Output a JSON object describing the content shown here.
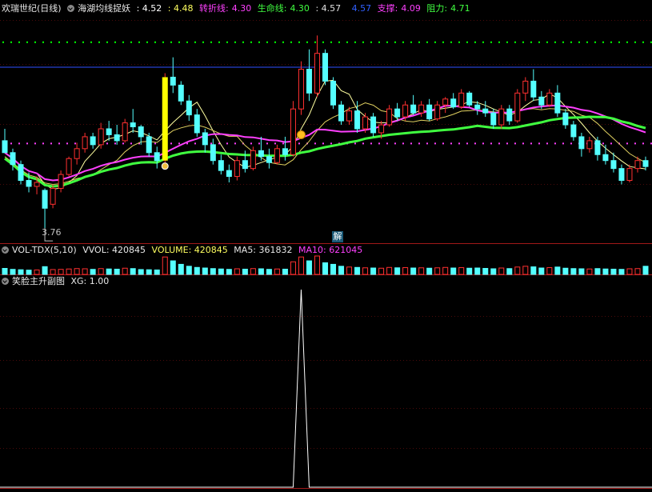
{
  "header": {
    "stock_name": "欢瑞世纪(日线)",
    "indicator_name": "海湖均线捉妖",
    "val1": ": 4.52",
    "val2": ": 4.48",
    "zhuanzhe_label": "转折线:",
    "zhuanzhe_val": "4.30",
    "shengming_label": "生命线:",
    "shengming_val": "4.30",
    "val3": ": 4.57",
    "val4": "4.57",
    "zhicheng_label": "支撑:",
    "zhicheng_val": "4.09",
    "zuli_label": "阻力:",
    "zuli_val": "4.71"
  },
  "vol_header": {
    "name": "VOL-TDX(5,10)",
    "vvol": "VVOL: 420845",
    "volume": "VOLUME: 420845",
    "ma5": "MA5: 361832",
    "ma10": "MA10: 621045"
  },
  "xg_header": {
    "name": "笑脸主升副图",
    "xg": "XG: 1.00"
  },
  "low_label": "3.76",
  "jie_label": "解",
  "colors": {
    "up": "#ff3030",
    "down": "#54ffff",
    "ma_fast": "#ffffa0",
    "zhuanzhe": "#ff40ff",
    "shengming": "#40ff40",
    "blue_line": "#3050ff",
    "dots_green": "#00ff00",
    "dots_pink": "#ff40ff",
    "bar_yellow": "#ffff00"
  },
  "chart_data": {
    "type": "candlestick",
    "candles": [
      [
        4.2,
        4.26,
        4.14,
        4.14
      ],
      [
        4.14,
        4.16,
        4.05,
        4.08
      ],
      [
        4.08,
        4.1,
        3.98,
        4.0
      ],
      [
        4.0,
        4.04,
        3.94,
        3.97
      ],
      [
        3.97,
        4.02,
        3.93,
        3.99
      ],
      [
        3.95,
        3.96,
        3.76,
        3.86
      ],
      [
        3.88,
        3.98,
        3.86,
        3.96
      ],
      [
        3.96,
        4.05,
        3.94,
        4.03
      ],
      [
        4.03,
        4.12,
        4.02,
        4.11
      ],
      [
        4.11,
        4.19,
        4.08,
        4.16
      ],
      [
        4.16,
        4.24,
        4.14,
        4.22
      ],
      [
        4.22,
        4.24,
        4.16,
        4.18
      ],
      [
        4.18,
        4.29,
        4.16,
        4.26
      ],
      [
        4.26,
        4.3,
        4.2,
        4.23
      ],
      [
        4.23,
        4.28,
        4.18,
        4.2
      ],
      [
        4.2,
        4.31,
        4.19,
        4.29
      ],
      [
        4.29,
        4.36,
        4.24,
        4.27
      ],
      [
        4.27,
        4.28,
        4.18,
        4.22
      ],
      [
        4.22,
        4.24,
        4.12,
        4.14
      ],
      [
        4.14,
        4.17,
        4.06,
        4.1
      ],
      [
        4.1,
        4.54,
        4.09,
        4.52
      ],
      [
        4.52,
        4.62,
        4.44,
        4.48
      ],
      [
        4.48,
        4.5,
        4.38,
        4.4
      ],
      [
        4.4,
        4.43,
        4.3,
        4.33
      ],
      [
        4.33,
        4.36,
        4.22,
        4.24
      ],
      [
        4.24,
        4.26,
        4.14,
        4.18
      ],
      [
        4.18,
        4.21,
        4.08,
        4.1
      ],
      [
        4.1,
        4.13,
        4.03,
        4.05
      ],
      [
        4.05,
        4.08,
        3.99,
        4.02
      ],
      [
        4.02,
        4.12,
        4.0,
        4.1
      ],
      [
        4.1,
        4.15,
        4.04,
        4.06
      ],
      [
        4.06,
        4.17,
        4.05,
        4.15
      ],
      [
        4.15,
        4.22,
        4.1,
        4.12
      ],
      [
        4.12,
        4.16,
        4.06,
        4.09
      ],
      [
        4.09,
        4.18,
        4.08,
        4.16
      ],
      [
        4.16,
        4.22,
        4.1,
        4.13
      ],
      [
        4.13,
        4.4,
        4.12,
        4.36
      ],
      [
        4.36,
        4.6,
        4.33,
        4.56
      ],
      [
        4.56,
        4.66,
        4.4,
        4.44
      ],
      [
        4.44,
        4.73,
        4.42,
        4.64
      ],
      [
        4.64,
        4.66,
        4.48,
        4.5
      ],
      [
        4.5,
        4.52,
        4.36,
        4.38
      ],
      [
        4.38,
        4.4,
        4.28,
        4.3
      ],
      [
        4.3,
        4.37,
        4.28,
        4.35
      ],
      [
        4.35,
        4.4,
        4.24,
        4.26
      ],
      [
        4.26,
        4.34,
        4.24,
        4.32
      ],
      [
        4.32,
        4.34,
        4.22,
        4.24
      ],
      [
        4.24,
        4.3,
        4.21,
        4.28
      ],
      [
        4.28,
        4.38,
        4.27,
        4.36
      ],
      [
        4.36,
        4.39,
        4.3,
        4.32
      ],
      [
        4.32,
        4.4,
        4.3,
        4.38
      ],
      [
        4.38,
        4.43,
        4.33,
        4.34
      ],
      [
        4.34,
        4.4,
        4.32,
        4.38
      ],
      [
        4.38,
        4.41,
        4.3,
        4.31
      ],
      [
        4.31,
        4.4,
        4.3,
        4.38
      ],
      [
        4.38,
        4.42,
        4.34,
        4.41
      ],
      [
        4.41,
        4.44,
        4.36,
        4.37
      ],
      [
        4.37,
        4.46,
        4.36,
        4.44
      ],
      [
        4.44,
        4.45,
        4.37,
        4.38
      ],
      [
        4.38,
        4.4,
        4.33,
        4.36
      ],
      [
        4.36,
        4.4,
        4.32,
        4.34
      ],
      [
        4.34,
        4.36,
        4.26,
        4.28
      ],
      [
        4.28,
        4.38,
        4.26,
        4.36
      ],
      [
        4.36,
        4.38,
        4.28,
        4.3
      ],
      [
        4.3,
        4.46,
        4.29,
        4.44
      ],
      [
        4.44,
        4.52,
        4.4,
        4.5
      ],
      [
        4.5,
        4.56,
        4.4,
        4.42
      ],
      [
        4.42,
        4.45,
        4.36,
        4.38
      ],
      [
        4.38,
        4.46,
        4.37,
        4.44
      ],
      [
        4.44,
        4.48,
        4.32,
        4.34
      ],
      [
        4.34,
        4.36,
        4.26,
        4.28
      ],
      [
        4.28,
        4.3,
        4.2,
        4.22
      ],
      [
        4.22,
        4.24,
        4.12,
        4.16
      ],
      [
        4.16,
        4.22,
        4.14,
        4.2
      ],
      [
        4.2,
        4.22,
        4.1,
        4.13
      ],
      [
        4.13,
        4.18,
        4.08,
        4.1
      ],
      [
        4.1,
        4.14,
        4.04,
        4.06
      ],
      [
        4.06,
        4.08,
        3.98,
        4.0
      ],
      [
        4.0,
        4.08,
        3.99,
        4.06
      ],
      [
        4.06,
        4.12,
        4.04,
        4.1
      ],
      [
        4.1,
        4.12,
        4.05,
        4.07
      ]
    ],
    "ylim": [
      3.7,
      4.82
    ],
    "volume": [
      310,
      260,
      240,
      220,
      230,
      400,
      250,
      260,
      280,
      300,
      290,
      260,
      300,
      280,
      270,
      320,
      300,
      250,
      240,
      230,
      900,
      700,
      520,
      420,
      360,
      330,
      300,
      280,
      260,
      290,
      270,
      300,
      290,
      260,
      280,
      270,
      650,
      900,
      700,
      950,
      600,
      520,
      420,
      380,
      360,
      340,
      330,
      320,
      360,
      340,
      350,
      330,
      340,
      320,
      340,
      360,
      330,
      350,
      320,
      330,
      310,
      290,
      330,
      300,
      380,
      420,
      390,
      330,
      350,
      380,
      320,
      300,
      290,
      280,
      300,
      280,
      270,
      260,
      290,
      300,
      420
    ],
    "xg_signal_index": 37,
    "xg_value": 1.0
  }
}
